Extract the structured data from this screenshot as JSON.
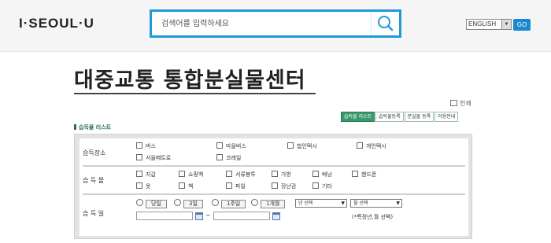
{
  "header": {
    "logo_text": "I·SEOUL·U",
    "search_placeholder": "검색어를 입력하세요",
    "language": "ENGLISH",
    "go_label": "GO"
  },
  "page": {
    "title": "대중교통 통합분실물센터",
    "print_label": "인쇄",
    "section_label": "습득물 리스트"
  },
  "tabs": [
    "습득물 리스트",
    "습득물등록",
    "분실물 등록",
    "이용안내"
  ],
  "form": {
    "place": {
      "label": "습득장소",
      "options": [
        "버스",
        "마을버스",
        "법인택시",
        "개인택시",
        "서울메트로",
        "코레일"
      ]
    },
    "item": {
      "label": "습 득 물",
      "options": [
        "지갑",
        "쇼핑백",
        "서류봉투",
        "가방",
        "배낭",
        "핸드폰",
        "옷",
        "책",
        "파일",
        "장난감",
        "기타"
      ]
    },
    "date": {
      "label": "습 득 일",
      "periods": [
        "당일",
        "3일",
        "1주일",
        "1개월"
      ],
      "year_select": "년 선택",
      "month_select": "월 선택",
      "range_sep": "~",
      "hint": "(*특정년,월 선택)"
    }
  },
  "colors": {
    "accent": "#1f9ad8",
    "tab_active": "#3a9a6e"
  }
}
